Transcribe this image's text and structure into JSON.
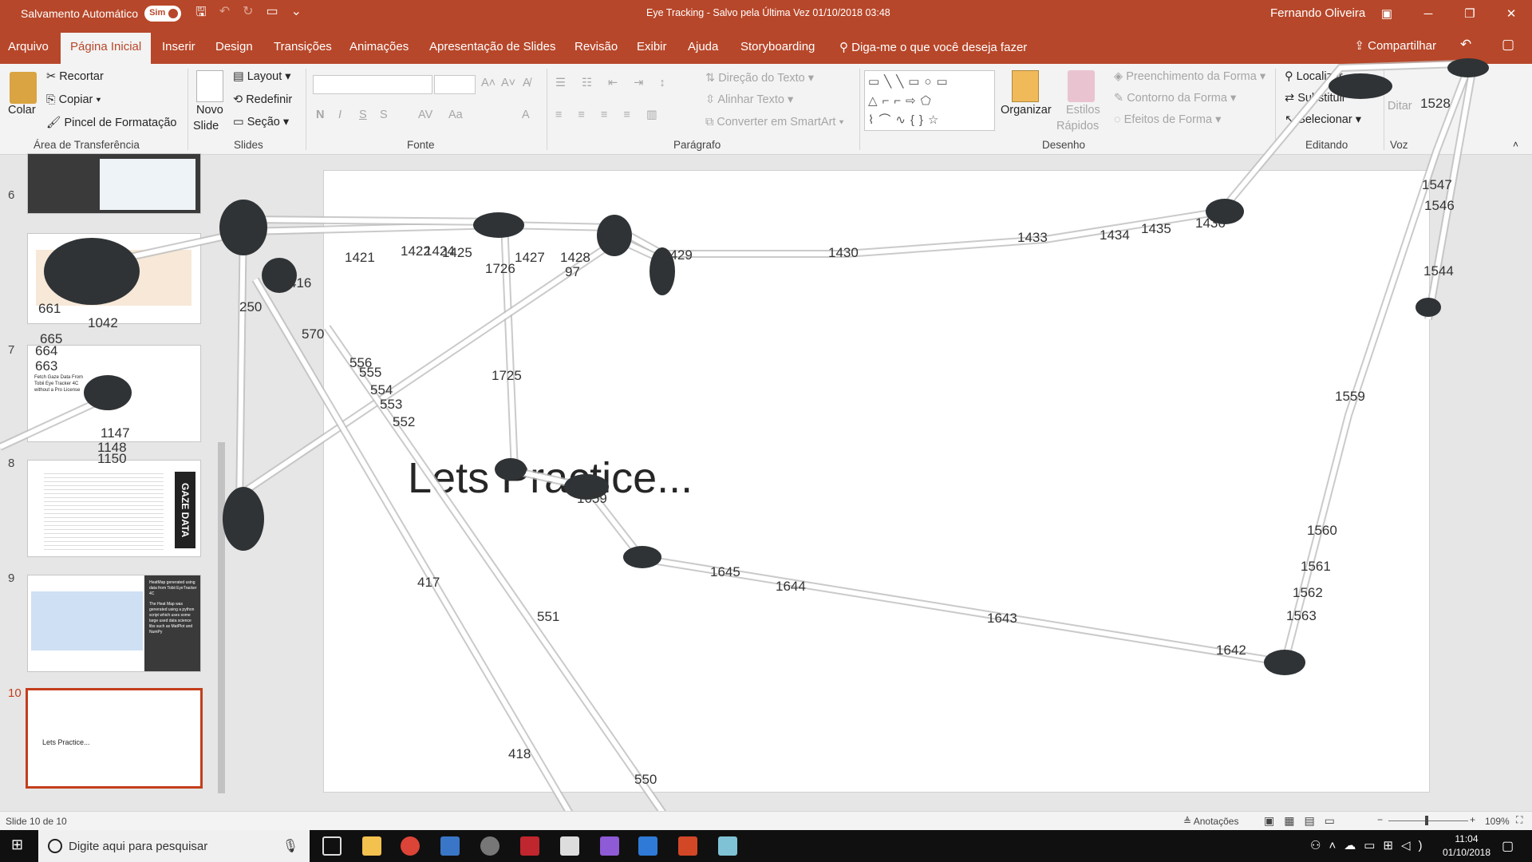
{
  "titlebar": {
    "autosave_label": "Salvamento Automático",
    "autosave_state": "Sim",
    "doc_title": "Eye Tracking  -  Salvo pela Última Vez 01/10/2018 03:48",
    "user": "Fernando Oliveira"
  },
  "tabs": [
    "Arquivo",
    "Página Inicial",
    "Inserir",
    "Design",
    "Transições",
    "Animações",
    "Apresentação de Slides",
    "Revisão",
    "Exibir",
    "Ajuda",
    "Storyboarding"
  ],
  "tell_me": "Diga-me o que você deseja fazer",
  "share": "Compartilhar",
  "ribbon": {
    "clipboard": {
      "paste": "Colar",
      "cut": "Recortar",
      "copy": "Copiar",
      "format_painter": "Pincel de Formatação",
      "group": "Área de Transferência"
    },
    "slides": {
      "new_slide_1": "Novo",
      "new_slide_2": "Slide",
      "layout": "Layout",
      "reset": "Redefinir",
      "section": "Seção",
      "group": "Slides"
    },
    "font": {
      "group": "Fonte",
      "bold": "N",
      "italic": "I",
      "underline": "S",
      "shadow": "S",
      "spacing": "AV",
      "case": "Aa",
      "color": "A"
    },
    "paragraph": {
      "text_direction": "Direção do Texto",
      "align_text": "Alinhar Texto",
      "smartart": "Converter em SmartArt",
      "group": "Parágrafo"
    },
    "drawing": {
      "arrange": "Organizar",
      "quick_styles_1": "Estilos",
      "quick_styles_2": "Rápidos",
      "fill": "Preenchimento da Forma",
      "outline": "Contorno da Forma",
      "effects": "Efeitos de Forma",
      "group": "Desenho"
    },
    "editing": {
      "find": "Localizar",
      "replace": "Substituir",
      "select": "Selecionar",
      "group": "Editando"
    },
    "voice": {
      "dictate": "Ditar",
      "group": "Voz"
    }
  },
  "thumbnails": [
    {
      "num": "6"
    },
    {
      "num": "7",
      "text": "Fetch Gaze Data From Tobii Eye Tracker 4C without a Pro License"
    },
    {
      "num": "8",
      "side_label": "GAZE DATA"
    },
    {
      "num": "9",
      "bullets": [
        "HeatMap generated using data from Tobii EyeTracker 4C",
        "The Heat Map was generated using a python script which uses some large used data science libs such as MatPlot and NumPy"
      ]
    },
    {
      "num": "10",
      "text": "Lets Practice..."
    }
  ],
  "slide": {
    "title": "Lets Practice..."
  },
  "gaze_labels": [
    {
      "t": "1421"
    },
    {
      "t": "1422"
    },
    {
      "t": "1424"
    },
    {
      "t": "1425"
    },
    {
      "t": "1427"
    },
    {
      "t": "1428"
    },
    {
      "t": "1429"
    },
    {
      "t": "1430"
    },
    {
      "t": "1433"
    },
    {
      "t": "1434"
    },
    {
      "t": "1435"
    },
    {
      "t": "1436"
    },
    {
      "t": "1726"
    },
    {
      "t": "1725"
    },
    {
      "t": "97"
    },
    {
      "t": "570"
    },
    {
      "t": "556"
    },
    {
      "t": "555"
    },
    {
      "t": "554"
    },
    {
      "t": "553"
    },
    {
      "t": "552"
    },
    {
      "t": "551"
    },
    {
      "t": "550"
    },
    {
      "t": "417"
    },
    {
      "t": "418"
    },
    {
      "t": "416"
    },
    {
      "t": "250"
    },
    {
      "t": "1559"
    },
    {
      "t": "1560"
    },
    {
      "t": "1561"
    },
    {
      "t": "1562"
    },
    {
      "t": "1563"
    },
    {
      "t": "1528"
    },
    {
      "t": "1547"
    },
    {
      "t": "1546"
    },
    {
      "t": "1544"
    },
    {
      "t": "1643"
    },
    {
      "t": "1644"
    },
    {
      "t": "1645"
    },
    {
      "t": "1642"
    },
    {
      "t": "1659"
    },
    {
      "t": "1042"
    },
    {
      "t": "661"
    },
    {
      "t": "665"
    },
    {
      "t": "664"
    },
    {
      "t": "663"
    },
    {
      "t": "1147"
    },
    {
      "t": "1148"
    },
    {
      "t": "1150"
    }
  ],
  "status": {
    "slide_info": "Slide 10 de 10",
    "notes": "Anotações",
    "zoom": "109%"
  },
  "taskbar": {
    "search": "Digite aqui para pesquisar",
    "time": "11:04",
    "date": "01/10/2018"
  },
  "colors": {
    "accent": "#b7472a",
    "selected_thumb": "#c43e1c"
  }
}
